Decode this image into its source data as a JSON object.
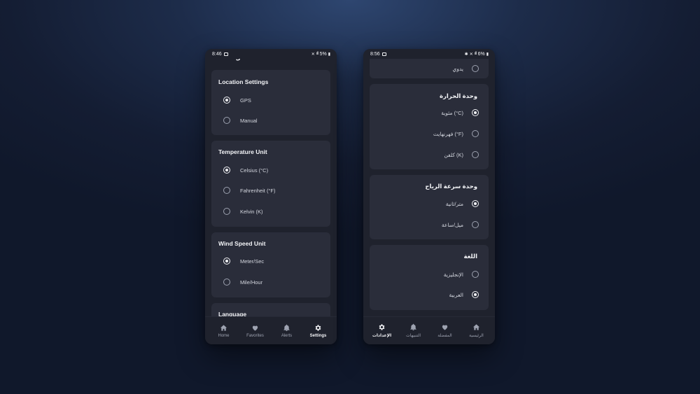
{
  "phone_en": {
    "status": {
      "time": "8:46",
      "battery": "5%"
    },
    "title": "Settings",
    "sections": [
      {
        "title": "Location Settings",
        "options": [
          {
            "label": "GPS",
            "selected": true
          },
          {
            "label": "Manual",
            "selected": false
          }
        ]
      },
      {
        "title": "Temperature Unit",
        "options": [
          {
            "label": "Celsius (°C)",
            "selected": true
          },
          {
            "label": "Fahrenheit (°F)",
            "selected": false
          },
          {
            "label": "Kelvin (K)",
            "selected": false
          }
        ]
      },
      {
        "title": "Wind Speed Unit",
        "options": [
          {
            "label": "Meter/Sec",
            "selected": true
          },
          {
            "label": "Mile/Hour",
            "selected": false
          }
        ]
      },
      {
        "title": "Language",
        "options": []
      }
    ],
    "nav": [
      {
        "label": "Home",
        "icon": "home-icon",
        "active": false
      },
      {
        "label": "Favorites",
        "icon": "heart-icon",
        "active": false
      },
      {
        "label": "Alerts",
        "icon": "bell-icon",
        "active": false
      },
      {
        "label": "Settings",
        "icon": "gear-icon",
        "active": true
      }
    ]
  },
  "phone_ar": {
    "status": {
      "time": "8:56",
      "battery": "6%"
    },
    "sections": [
      {
        "title": "",
        "options": [
          {
            "label": "يدوي",
            "selected": false
          }
        ]
      },
      {
        "title": "وحدة الحرارة",
        "options": [
          {
            "label": "مئوية (°C)",
            "selected": true
          },
          {
            "label": "فهرنهايت (°F)",
            "selected": false
          },
          {
            "label": "كلفن (K)",
            "selected": false
          }
        ]
      },
      {
        "title": "وحدة سرعة الرياح",
        "options": [
          {
            "label": "متر/ثانية",
            "selected": true
          },
          {
            "label": "ميل/ساعة",
            "selected": false
          }
        ]
      },
      {
        "title": "اللغة",
        "options": [
          {
            "label": "الإنجليزية",
            "selected": false
          },
          {
            "label": "العربية",
            "selected": true
          }
        ]
      }
    ],
    "nav": [
      {
        "label": "الإعدادات",
        "icon": "gear-icon",
        "active": true
      },
      {
        "label": "التنبيهات",
        "icon": "bell-icon",
        "active": false
      },
      {
        "label": "المفضلة",
        "icon": "heart-icon",
        "active": false
      },
      {
        "label": "الرئيسية",
        "icon": "home-icon",
        "active": false
      }
    ]
  },
  "colors": {
    "background": "#141d33",
    "phone": "#1f222d",
    "card": "#2a2d3a",
    "text": "#f3f4f7",
    "muted": "#9ea3b1"
  }
}
